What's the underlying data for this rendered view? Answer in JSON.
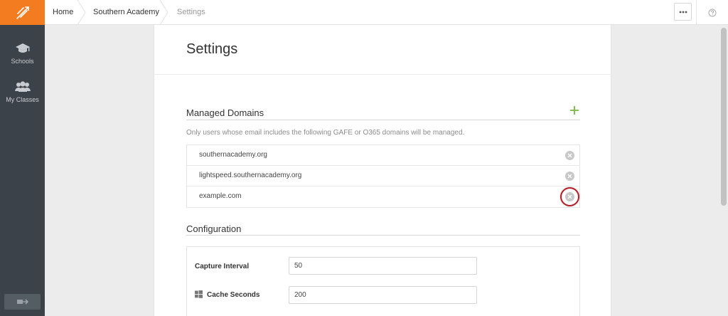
{
  "breadcrumb": {
    "home": "Home",
    "school": "Southern Academy",
    "current": "Settings"
  },
  "sidebar": {
    "items": [
      {
        "label": "Schools",
        "icon": "graduation-cap-icon"
      },
      {
        "label": "My Classes",
        "icon": "users-icon"
      }
    ],
    "logout_icon": "logout-icon"
  },
  "page": {
    "title": "Settings"
  },
  "managed_domains": {
    "title": "Managed Domains",
    "hint": "Only users whose email includes the following GAFE or O365 domains will be managed.",
    "domains": [
      "southernacademy.org",
      "lightspeed.southernacademy.org",
      "example.com"
    ]
  },
  "configuration": {
    "title": "Configuration",
    "fields": [
      {
        "label": "Capture Interval",
        "value": "50"
      },
      {
        "label": "Cache Seconds",
        "value": "200",
        "icon": "windows-icon"
      }
    ]
  },
  "colors": {
    "brand": "#f47c20",
    "sidebar": "#3b4249",
    "add_green": "#7cb342",
    "highlight_red": "#b51c24"
  }
}
